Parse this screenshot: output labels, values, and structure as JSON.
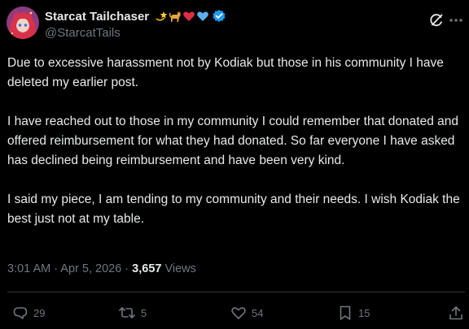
{
  "author": {
    "display_name": "Starcat Tailchaser",
    "handle": "@StarcatTails",
    "name_emojis": [
      "dizzy-star",
      "cat",
      "red-heart",
      "blue-heart"
    ],
    "verified": true
  },
  "post": {
    "paragraphs": [
      "Due to excessive harassment not by Kodiak but those in his community I have deleted my earlier post.",
      "I have reached out to those in my community I could remember that donated and offered reimbursement for what they had donated. So far everyone I have asked has declined being reimbursement and have been very kind.",
      "I said my piece, I am tending to my community and their needs. I wish Kodiak the best just not at my table."
    ],
    "timestamp": "3:01 AM · Apr 5, 2026 · ",
    "views_count": "3,657",
    "views_label": " Views"
  },
  "actions": {
    "replies": "29",
    "reposts": "5",
    "likes": "54",
    "bookmarks": "15"
  },
  "colors": {
    "background": "#000000",
    "text": "#e7e9ea",
    "secondary": "#71767b",
    "verified": "#1d9bf0",
    "divider": "#2f3336"
  },
  "icons": {
    "grok": "grok-icon",
    "reply": "reply-icon",
    "repost": "repost-icon",
    "like": "heart-icon",
    "bookmark": "bookmark-icon",
    "share": "share-icon"
  }
}
